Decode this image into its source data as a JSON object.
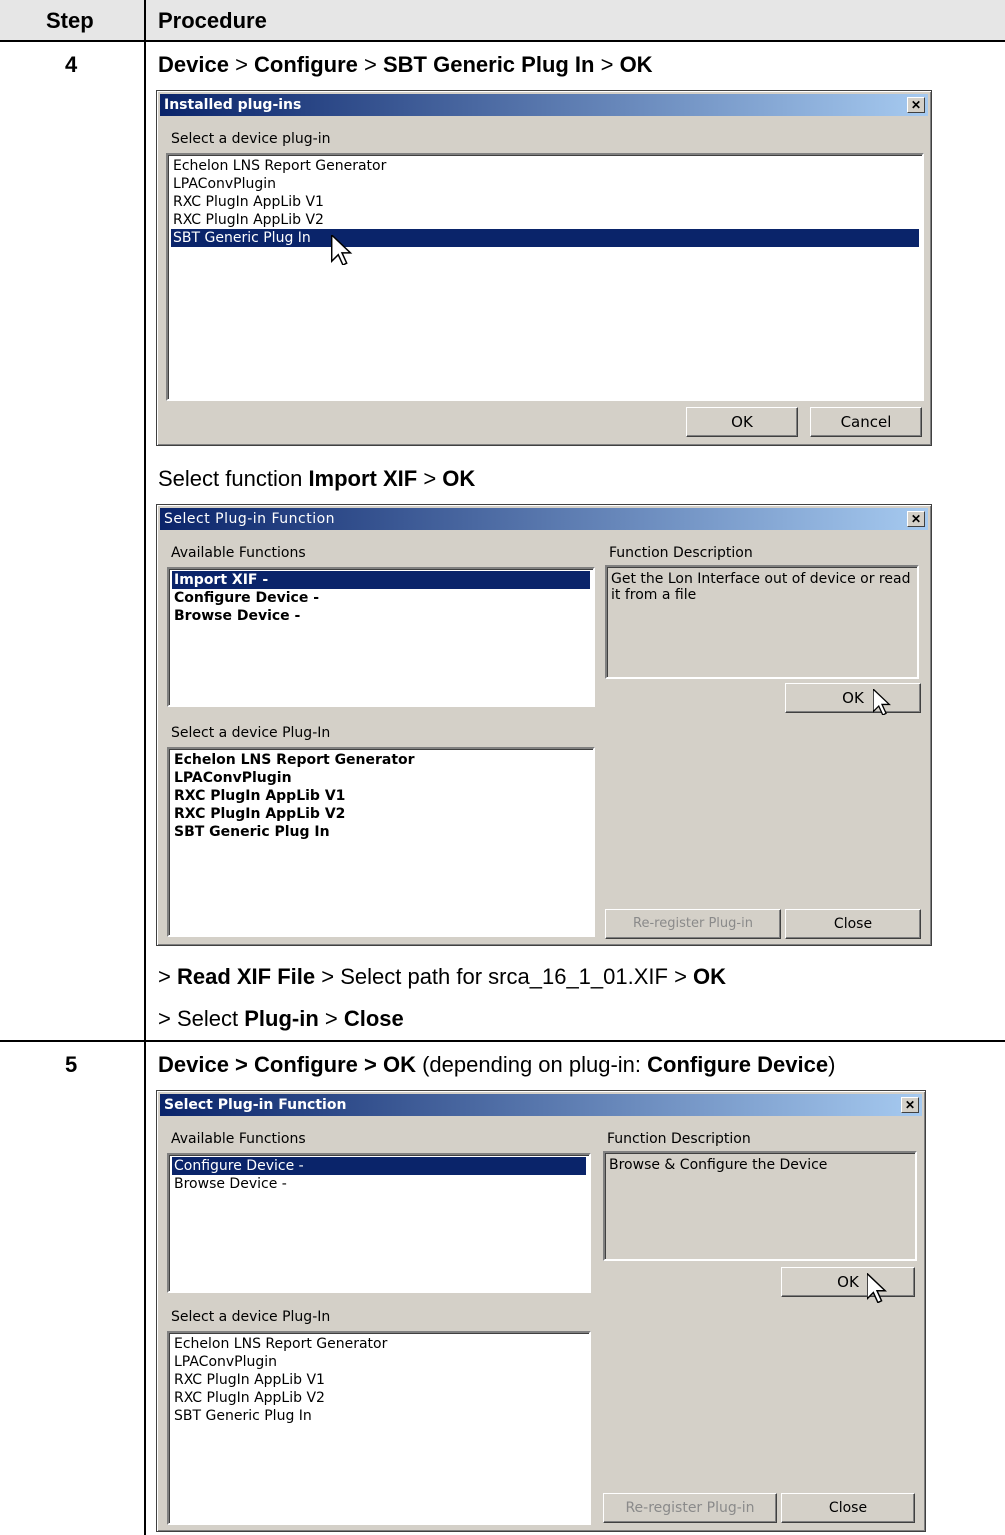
{
  "header": {
    "step": "Step",
    "procedure": "Procedure"
  },
  "step4": {
    "number": "4",
    "line1": {
      "t1": "Device",
      "s1": " > ",
      "t2": "Configure",
      "s2": " > ",
      "t3": "SBT Generic Plug In",
      "s3": " > ",
      "t4": "OK"
    },
    "dialog1": {
      "title": "Installed plug-ins",
      "label": "Select a device plug-in",
      "items": [
        "Echelon LNS Report Generator",
        "LPAConvPlugin",
        "RXC PlugIn AppLib V1",
        "RXC PlugIn AppLib V2",
        "SBT Generic Plug In"
      ],
      "selected_index": 4,
      "ok": "OK",
      "cancel": "Cancel"
    },
    "line2": {
      "pre": "Select function ",
      "b1": "Import XIF",
      "s1": " > ",
      "b2": "OK"
    },
    "dialog2": {
      "title": "Select Plug-in Function",
      "functions_label": "Available Functions",
      "functions": [
        "Import XIF -",
        "Configure Device -",
        "Browse Device -"
      ],
      "selected_function": 0,
      "desc_label": "Function Description",
      "desc_text": "Get the Lon Interface out of device or read it from a file",
      "ok": "OK",
      "plugins_label": "Select a device Plug-In",
      "plugins": [
        "Echelon LNS Report Generator",
        "LPAConvPlugin",
        "RXC PlugIn AppLib V1",
        "RXC PlugIn AppLib V2",
        "SBT Generic Plug In"
      ],
      "reregister": "Re-register Plug-in",
      "close": "Close"
    },
    "line3": {
      "pre": "> ",
      "b1": "Read XIF File",
      "mid": " > Select path for srca_16_1_01.XIF > ",
      "b2": "OK"
    },
    "line4": {
      "pre": "> Select ",
      "b1": "Plug-in",
      "s1": " > ",
      "b2": "Close"
    }
  },
  "step5": {
    "number": "5",
    "line1": {
      "b1": "Device > Configure > OK",
      "mid": " (depending on plug-in: ",
      "b2": "Configure Device",
      "end": ")"
    },
    "dialog3": {
      "title": "Select Plug-in Function",
      "functions_label": "Available Functions",
      "functions": [
        "Configure Device -",
        "Browse Device -"
      ],
      "selected_function": 0,
      "desc_label": "Function Description",
      "desc_text": "Browse & Configure the Device",
      "ok": "OK",
      "plugins_label": "Select a device Plug-In",
      "plugins": [
        "Echelon LNS Report Generator",
        "LPAConvPlugin",
        "RXC PlugIn AppLib V1",
        "RXC PlugIn AppLib V2",
        "SBT Generic Plug In"
      ],
      "reregister": "Re-register Plug-in",
      "close": "Close"
    }
  },
  "colors": {
    "selection": "#0a246a",
    "dialog_bg": "#d4d0c8",
    "header_bg": "#e6e6e6"
  }
}
